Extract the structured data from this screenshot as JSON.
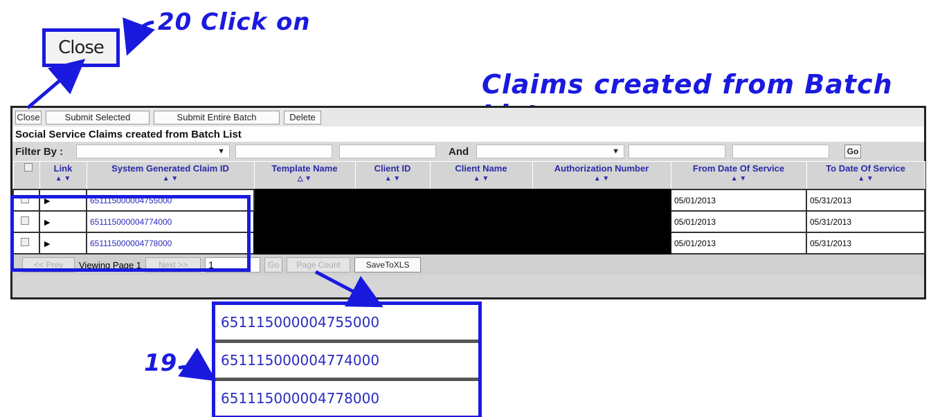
{
  "annotations": {
    "step20": "20 Click on",
    "step19": "19",
    "title": "Claims created from Batch List",
    "close_callout": "Close"
  },
  "toolbar": {
    "close": "Close",
    "submit_selected": "Submit Selected",
    "submit_entire_batch": "Submit Entire Batch",
    "delete": "Delete"
  },
  "heading": "Social Service Claims created from Batch List",
  "filter": {
    "label": "Filter By :",
    "and_label": "And",
    "go": "Go"
  },
  "columns": [
    "Link",
    "System Generated Claim ID",
    "Template Name",
    "Client ID",
    "Client Name",
    "Authorization Number",
    "From Date Of Service",
    "To Date Of Service"
  ],
  "rows": [
    {
      "claim_id": "651115000004755000",
      "from": "05/01/2013",
      "to": "05/31/2013"
    },
    {
      "claim_id": "651115000004774000",
      "from": "05/01/2013",
      "to": "05/31/2013"
    },
    {
      "claim_id": "651115000004778000",
      "from": "05/01/2013",
      "to": "05/31/2013"
    }
  ],
  "pager": {
    "prev": "<< Prev",
    "viewing": "Viewing Page 1",
    "next": "Next >>",
    "page_value": "1",
    "go": "Go",
    "page_count": "Page Count",
    "save_xls": "SaveToXLS"
  },
  "zoom_ids": [
    "651115000004755000",
    "651115000004774000",
    "651115000004778000"
  ],
  "colors": {
    "annotation": "#1a1adf",
    "link": "#2b2bbf",
    "header_text": "#2a2aa8"
  }
}
